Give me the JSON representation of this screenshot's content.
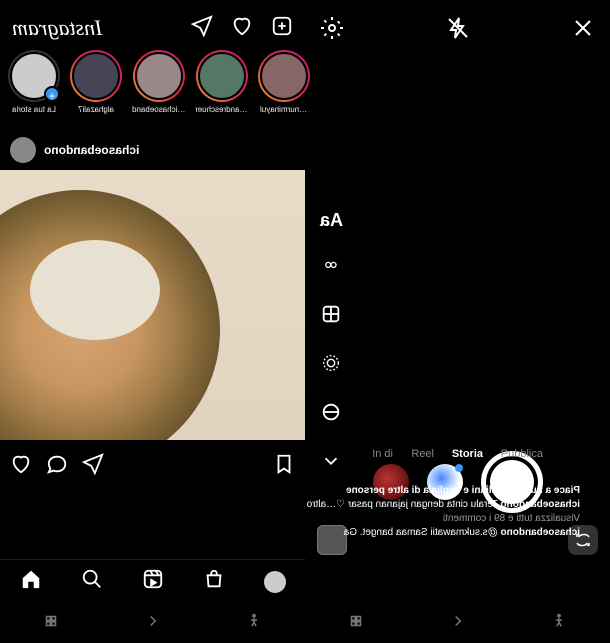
{
  "camera": {
    "modes": [
      "Pubblica",
      "Storia",
      "Reel",
      "In di"
    ],
    "active_mode": "Storia",
    "side_tools": [
      "text-icon",
      "infinity-icon",
      "layout-icon",
      "ring-icon",
      "circle-icon",
      "chevron-down-icon"
    ]
  },
  "feed": {
    "logo": "Instagram",
    "stories": [
      {
        "label": "La tua storia",
        "own": true
      },
      {
        "label": "alghazali7"
      },
      {
        "label": "ichasoeband…"
      },
      {
        "label": "andreschuer…"
      },
      {
        "label": "nurminayul…"
      }
    ],
    "post": {
      "username": "ichasoebandono",
      "likes_text": "Piace a nurminayuliani e migliaia di altre persone",
      "caption_user": "ichasoebandono",
      "caption_text": "Teralu cinta dengan jajanan pasar ♡…altro",
      "view_comments": "Visualizza tutti e 89 i commenti",
      "comment_user": "ichasoebandono",
      "comment_text": "@s.sukmawatii Samaa banget. Ga"
    }
  }
}
